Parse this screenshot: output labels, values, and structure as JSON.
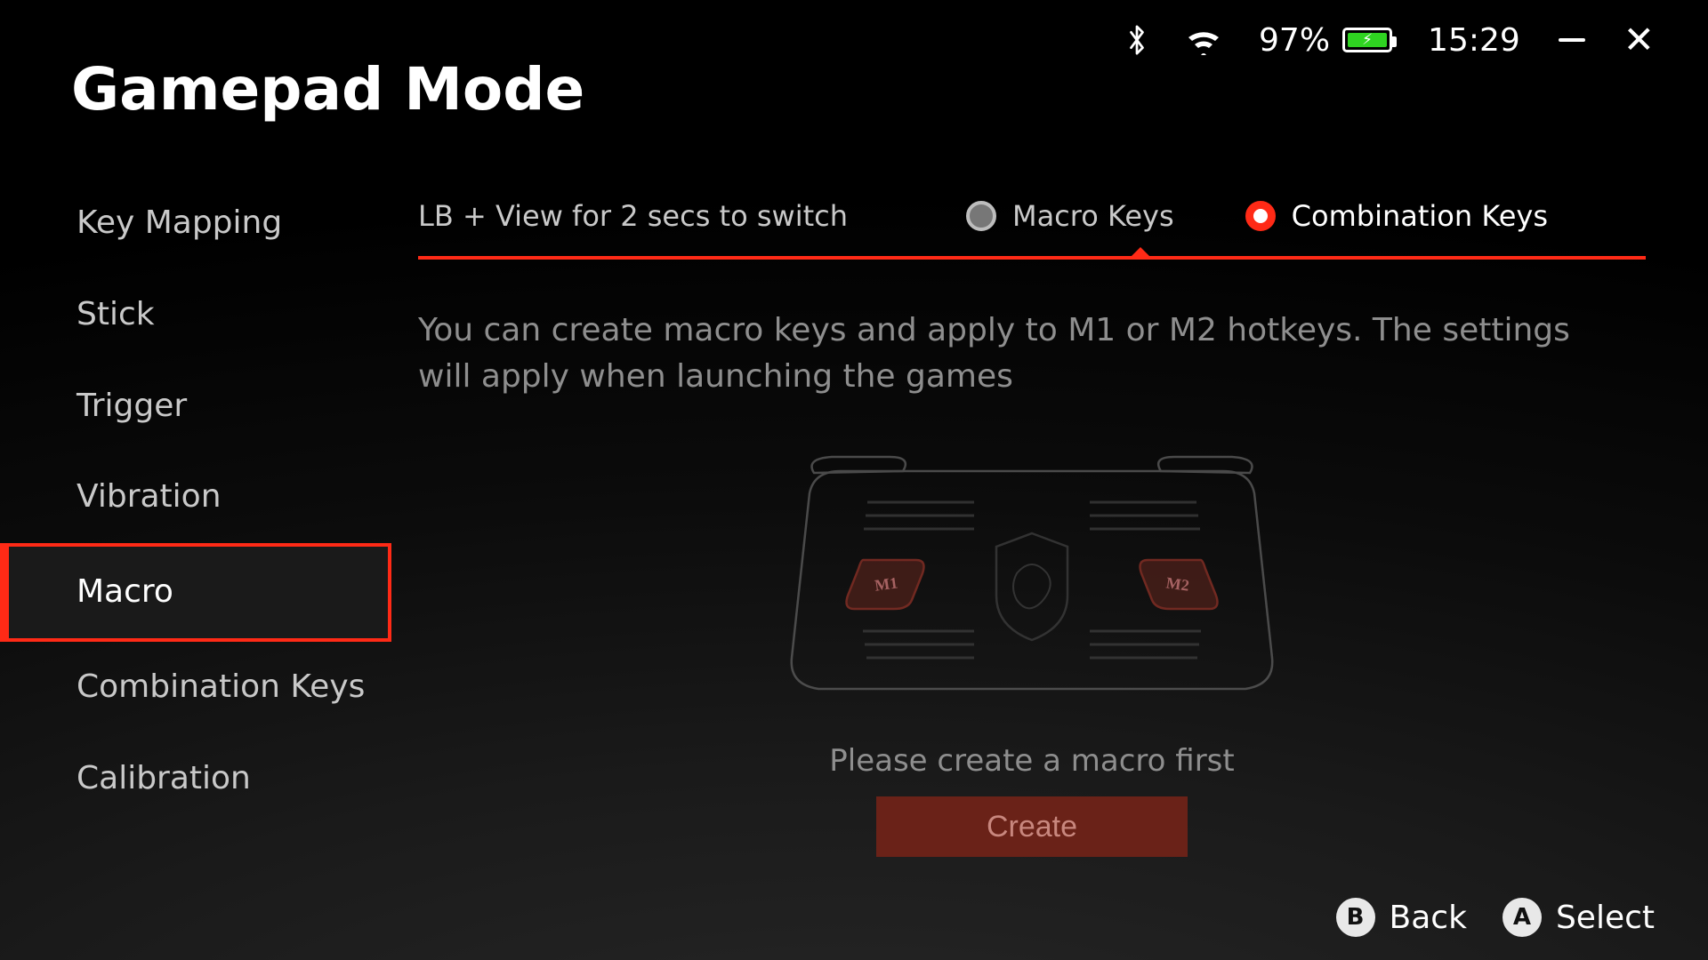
{
  "title": "Gamepad Mode",
  "status": {
    "battery_pct": "97%",
    "clock": "15:29"
  },
  "sidebar": {
    "items": [
      {
        "label": "Key Mapping",
        "id": "key-mapping"
      },
      {
        "label": "Stick",
        "id": "stick"
      },
      {
        "label": "Trigger",
        "id": "trigger"
      },
      {
        "label": "Vibration",
        "id": "vibration"
      },
      {
        "label": "Macro",
        "id": "macro"
      },
      {
        "label": "Combination Keys",
        "id": "combination-keys"
      },
      {
        "label": "Calibration",
        "id": "calibration"
      }
    ],
    "selected_index": 4
  },
  "macro": {
    "switch_hint": "LB + View for 2 secs to switch",
    "radio_options": [
      {
        "label": "Macro Keys",
        "selected": false
      },
      {
        "label": "Combination Keys",
        "selected": true
      }
    ],
    "description": "You can create macro keys and apply to M1 or M2 hotkeys. The settings will apply when launching the games",
    "prompt": "Please create a macro first",
    "create_label": "Create",
    "back_keys": {
      "m1": "M1",
      "m2": "M2"
    }
  },
  "footer": {
    "back_button_glyph": "B",
    "back_label": "Back",
    "select_button_glyph": "A",
    "select_label": "Select"
  }
}
